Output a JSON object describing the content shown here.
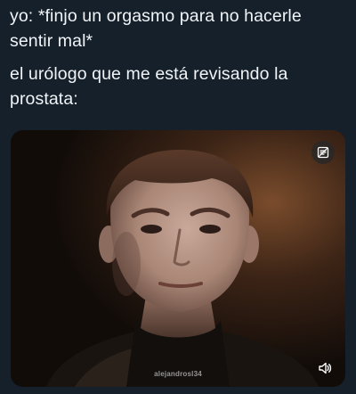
{
  "tweet": {
    "line_1": "yo: *finjo un orgasmo para no hacerle\nsentir mal*",
    "line_2": "el urólogo que me está revisando la\nprostata:"
  },
  "media": {
    "watermark": "alejandrosl34",
    "controls": {
      "top_right_icon": "gif-toggle-icon",
      "bottom_right_icon": "volume-icon"
    },
    "colors": {
      "background": "#15202b",
      "text": "#f1f4f7",
      "video_bg": "#140e0b"
    }
  }
}
